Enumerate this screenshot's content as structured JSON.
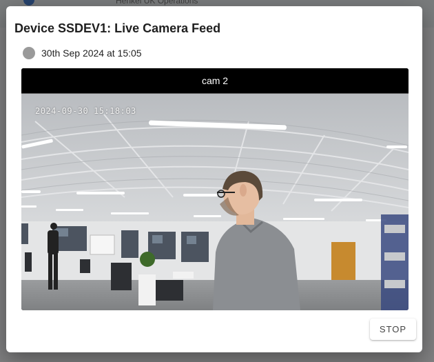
{
  "background": {
    "title": "Henkel UK Operations"
  },
  "dialog": {
    "title": "Device SSDEV1: Live Camera Feed",
    "status_time": "30th Sep 2024 at 15:05",
    "status_dot_color": "#9a9a9a",
    "camera": {
      "name": "cam 2",
      "overlay_timestamp": "2024-09-30 15:18:03"
    },
    "stop_label": "STOP"
  }
}
